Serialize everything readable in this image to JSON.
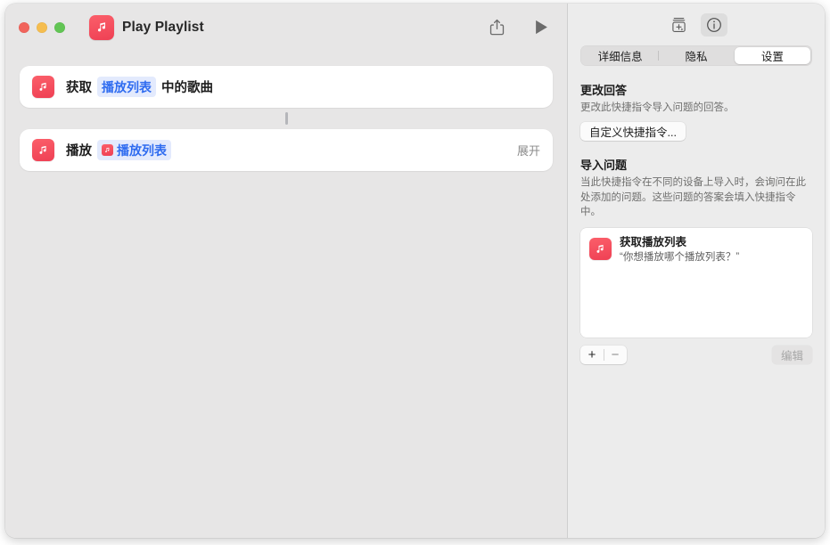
{
  "window": {
    "traffic_lights": [
      "close",
      "minimize",
      "zoom"
    ],
    "app_icon": "music-note-icon",
    "title": "Play Playlist",
    "share_icon": "share-icon",
    "run_icon": "play-icon"
  },
  "workflow": {
    "actions": [
      {
        "icon": "music-note-icon",
        "verb": "获取",
        "token": "播放列表",
        "token_has_icon": false,
        "tail": "中的歌曲",
        "right_label": ""
      },
      {
        "icon": "music-note-icon",
        "verb": "播放",
        "token": "播放列表",
        "token_has_icon": true,
        "tail": "",
        "right_label": "展开"
      }
    ]
  },
  "inspector": {
    "toolbar": {
      "add_to_gallery_icon": "shortcut-box-icon",
      "info_icon": "info-circle-icon"
    },
    "tabs": [
      {
        "label": "详细信息",
        "selected": false
      },
      {
        "label": "隐私",
        "selected": false
      },
      {
        "label": "设置",
        "selected": true
      }
    ],
    "change_answer": {
      "title": "更改回答",
      "description": "更改此快捷指令导入问题的回答。",
      "button_label": "自定义快捷指令..."
    },
    "import_questions": {
      "title": "导入问题",
      "description": "当此快捷指令在不同的设备上导入时，会询问在此处添加的问题。这些问题的答案会填入快捷指令中。",
      "items": [
        {
          "icon": "music-note-icon",
          "title": "获取播放列表",
          "prompt": "“你想播放哪个播放列表？”"
        }
      ],
      "add_label": "+",
      "remove_label": "−",
      "edit_label": "编辑"
    }
  }
}
